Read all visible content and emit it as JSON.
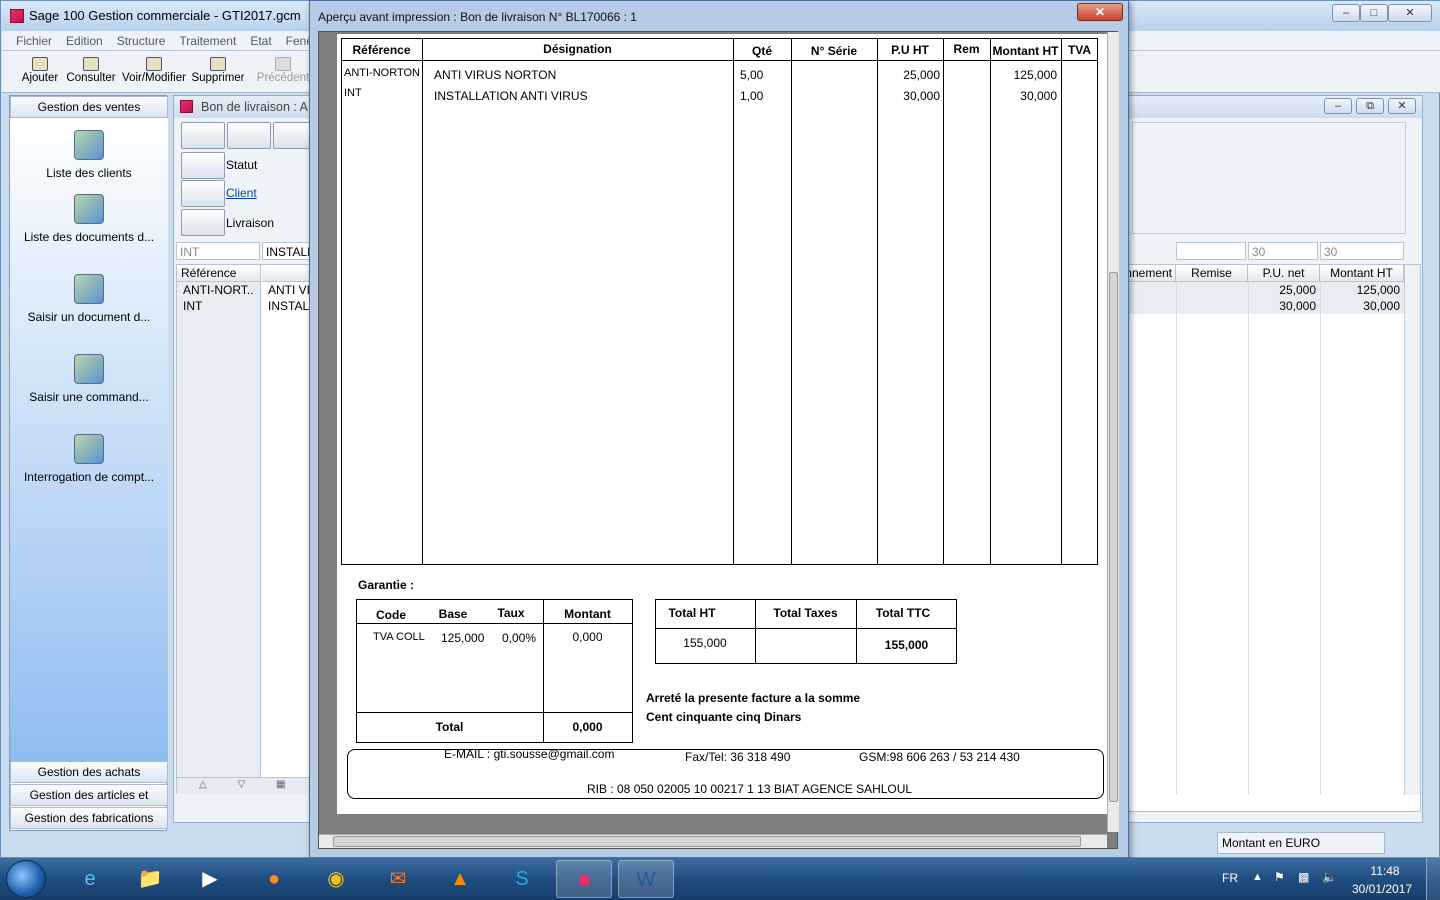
{
  "app": {
    "title": "Sage 100 Gestion commerciale - GTI2017.gcm",
    "menu": [
      "Fichier",
      "Edition",
      "Structure",
      "Traitement",
      "Etat",
      "Fenê"
    ],
    "toolbar": [
      "Ajouter",
      "Consulter",
      "Voir/Modifier",
      "Supprimer",
      "Précédent"
    ]
  },
  "left_panel": {
    "header": "Gestion des ventes",
    "items": [
      "Liste des clients",
      "Liste des documents d...",
      "Saisir un document d...",
      "Saisir une command...",
      "Interrogation de compt..."
    ],
    "sections": [
      "Gestion des achats",
      "Gestion des articles et stocks",
      "Gestion des fabrications"
    ]
  },
  "doc_window": {
    "title": "Bon de livraison : A f",
    "fields": [
      "Statut",
      "Client",
      "Livraison"
    ],
    "line_inputs": {
      "ref": "INT",
      "designation": "INSTALL",
      "qty": "30",
      "price": "30"
    },
    "left_grid": {
      "header": "Référence arti...",
      "rows": [
        {
          "ref": "ANTI-NORT..",
          "des": "ANTI VIR"
        },
        {
          "ref": "INT",
          "des": "INSTALL"
        }
      ]
    },
    "right_grid": {
      "headers": [
        "nnement",
        "Remise",
        "P.U. net",
        "Montant HT"
      ],
      "rows": [
        {
          "pu_net": "25,000",
          "montant": "125,000"
        },
        {
          "pu_net": "30,000",
          "montant": "30,000"
        }
      ]
    },
    "status_bar": "Montant en EURO"
  },
  "preview": {
    "title": "Aperçu avant impression : Bon de livraison N° BL170066 : 1",
    "table": {
      "headers": [
        "Référence",
        "Désignation",
        "Qté",
        "N° Série",
        "P.U HT",
        "Rem",
        "Montant HT",
        "TVA"
      ],
      "rows": [
        {
          "ref": "ANTI-NORTON",
          "des": "ANTI VIRUS NORTON",
          "qty": "5,00",
          "pu": "25,000",
          "montant": "125,000"
        },
        {
          "ref": "INT",
          "des": "INSTALLATION ANTI VIRUS",
          "qty": "1,00",
          "pu": "30,000",
          "montant": "30,000"
        }
      ]
    },
    "garantie_label": "Garantie :",
    "tax_table": {
      "headers": [
        "Code",
        "Base",
        "Taux",
        "Montant"
      ],
      "row": {
        "code": "TVA COLL",
        "base": "125,000",
        "taux": "0,00%",
        "montant": "0,000"
      },
      "total_label": "Total",
      "total_value": "0,000"
    },
    "totals": {
      "headers": [
        "Total HT",
        "Total Taxes",
        "Total TTC"
      ],
      "total_ht": "155,000",
      "total_taxes": "",
      "total_ttc": "155,000"
    },
    "amount_text_1": "Arreté la presente facture a la somme",
    "amount_text_2": "Cent cinquante cinq Dinars",
    "footer": {
      "email": "E-MAIL : gti.sousse@gmail.com",
      "fax": "Fax/Tel: 36 318 490",
      "gsm": "GSM:98 606 263 / 53 214 430",
      "rib": "RIB : 08 050 02005 10 00217 1 13 BIAT AGENCE SAHLOUL"
    }
  },
  "taskbar": {
    "lang": "FR",
    "time": "11:48",
    "date": "30/01/2017"
  }
}
